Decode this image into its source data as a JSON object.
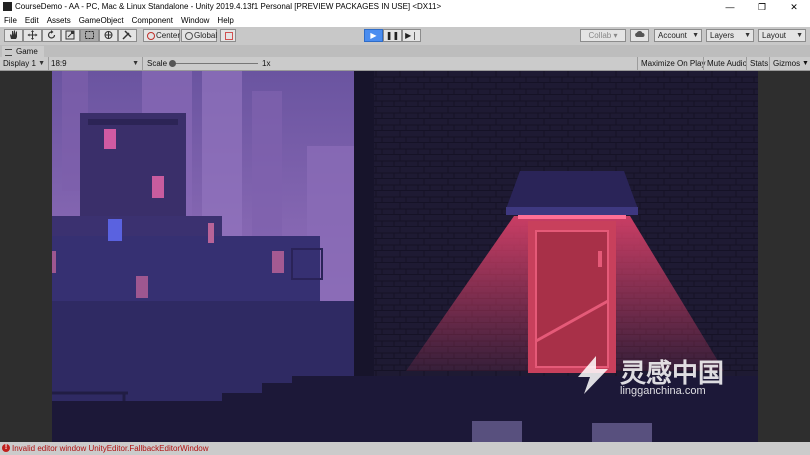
{
  "window": {
    "title": "CourseDemo - AA - PC, Mac & Linux Standalone - Unity 2019.4.13f1 Personal [PREVIEW PACKAGES IN USE] <DX11>",
    "controls": {
      "minimize": "—",
      "maximize": "❐",
      "close": "✕"
    }
  },
  "menu": [
    "File",
    "Edit",
    "Assets",
    "GameObject",
    "Component",
    "Window",
    "Help"
  ],
  "toolbar": {
    "transform_tools": [
      "hand-icon",
      "move-icon",
      "rotate-icon",
      "scale-icon",
      "rect-icon",
      "transform-icon",
      "custom-tool-icon"
    ],
    "pivot_label": "Center",
    "space_label": "Global",
    "play": "▶",
    "pause": "❚❚",
    "step": "▶❘",
    "collab_label": "Collab",
    "cloud_icon": "cloud-icon",
    "account_label": "Account",
    "layers_label": "Layers",
    "layout_label": "Layout"
  },
  "tab": {
    "label": "Game"
  },
  "gamebar": {
    "display": "Display 1",
    "aspect": "18:9",
    "scale_label": "Scale",
    "scale_value": "1x",
    "maximize_on_play": "Maximize On Play",
    "mute_audio": "Mute Audio",
    "stats": "Stats",
    "gizmos": "Gizmos"
  },
  "watermark": {
    "brand": "灵感中国",
    "site": "lingganchina.com"
  },
  "status": {
    "message": "Invalid editor window UnityEditor.FallbackEditorWindow"
  },
  "colors": {
    "sky": "#7a5fa8",
    "neon": "#e8446e",
    "wall": "#1e1a33",
    "play_active": "#4a8df0"
  }
}
